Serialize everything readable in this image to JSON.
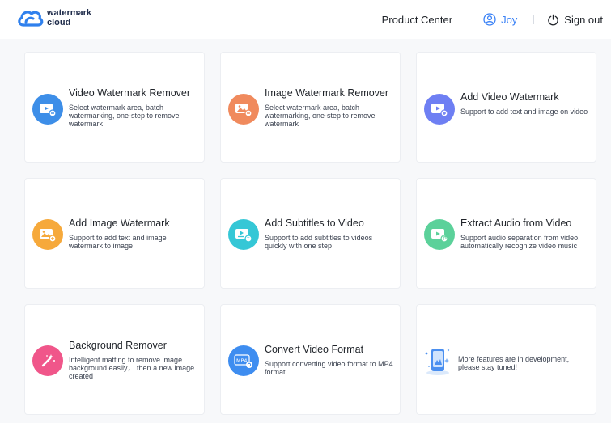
{
  "header": {
    "logo_line1": "watermark",
    "logo_line2": "cloud",
    "product_center": "Product Center",
    "user_name": "Joy",
    "sign_out": "Sign out"
  },
  "colors": {
    "accent": "#3b82f6",
    "blue": "#3d8ee8",
    "orange": "#f08a5d",
    "indigo": "#6e7ff3",
    "yellow": "#f6a93b",
    "teal": "#35c7d6",
    "green": "#5bd19a",
    "pink": "#f0568a",
    "royal": "#3e8df0"
  },
  "cards": [
    {
      "title": "Video Watermark Remover",
      "desc": "Select watermark area, batch watermarking, one-step to remove watermark",
      "icon": "video-remove-icon"
    },
    {
      "title": "Image Watermark Remover",
      "desc": "Select watermark area, batch watermarking, one-step to remove watermark",
      "icon": "image-remove-icon"
    },
    {
      "title": "Add Video Watermark",
      "desc": "Support to add text and image on video",
      "icon": "video-add-icon"
    },
    {
      "title": "Add Image Watermark",
      "desc": "Support to add text and image watermark to image",
      "icon": "image-add-icon"
    },
    {
      "title": "Add Subtitles to Video",
      "desc": "Support to add subtitles to videos quickly with one step",
      "icon": "subtitle-icon"
    },
    {
      "title": "Extract Audio from Video",
      "desc": "Support audio separation from video, automatically recognize video music",
      "icon": "audio-extract-icon"
    },
    {
      "title": "Background Remover",
      "desc": "Intelligent matting to remove image background easily， then a new image created",
      "icon": "magic-wand-icon"
    },
    {
      "title": "Convert Video Format",
      "desc": "Support converting video format to MP4 format",
      "icon": "mp4-convert-icon",
      "badge": "MP4"
    }
  ],
  "development": {
    "text": "More features are in development, please stay tuned!",
    "icon": "phone-development-icon"
  }
}
